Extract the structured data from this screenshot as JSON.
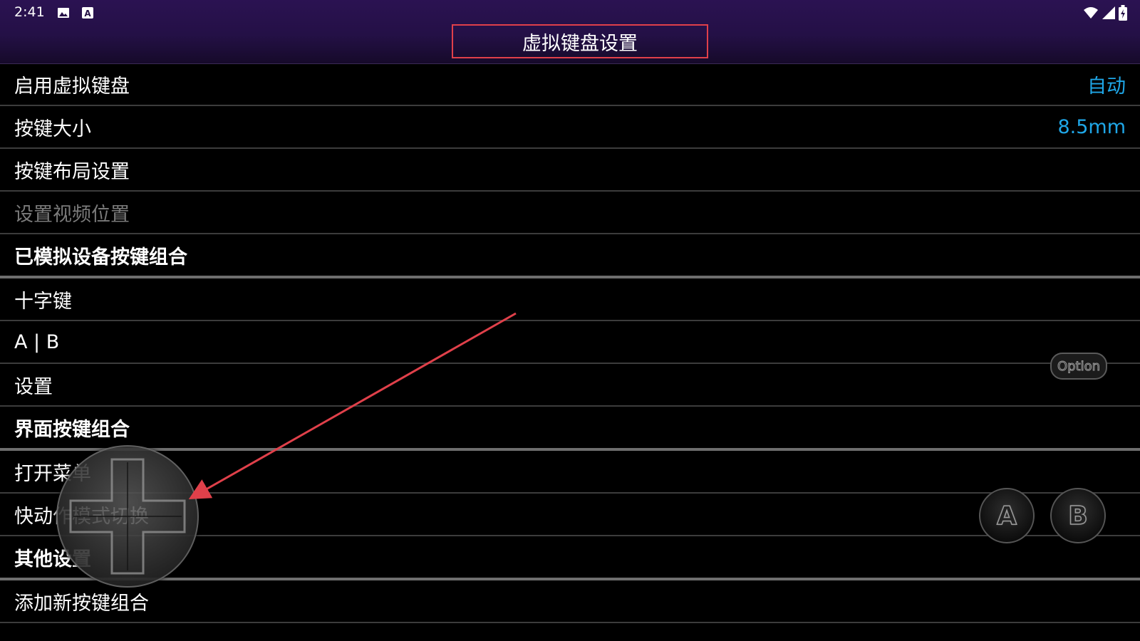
{
  "status_bar": {
    "time": "2:41",
    "left_icons": [
      "image-icon",
      "keyboard-a-icon"
    ],
    "right_icons": [
      "wifi-icon",
      "signal-icon",
      "battery-icon"
    ]
  },
  "header": {
    "title": "虚拟键盘设置"
  },
  "rows": [
    {
      "label": "启用虚拟键盘",
      "value": "自动"
    },
    {
      "label": "按键大小",
      "value": "8.5mm"
    },
    {
      "label": "按键布局设置"
    },
    {
      "label": "设置视频位置"
    },
    {
      "label": "已模拟设备按键组合"
    },
    {
      "label": "十字键"
    },
    {
      "label": "A | B"
    },
    {
      "label": "设置"
    },
    {
      "label": "界面按键组合"
    },
    {
      "label": "打开菜单"
    },
    {
      "label": "快动作模式切换"
    },
    {
      "label": "其他设置"
    },
    {
      "label": "添加新按键组合"
    }
  ],
  "overlay": {
    "button_a": "A",
    "button_b": "B",
    "button_option": "Option"
  },
  "colors": {
    "accent_value": "#1fa7e8",
    "highlight_box": "#e0404a",
    "arrow": "#e0404a",
    "header_bg": "#241046"
  }
}
